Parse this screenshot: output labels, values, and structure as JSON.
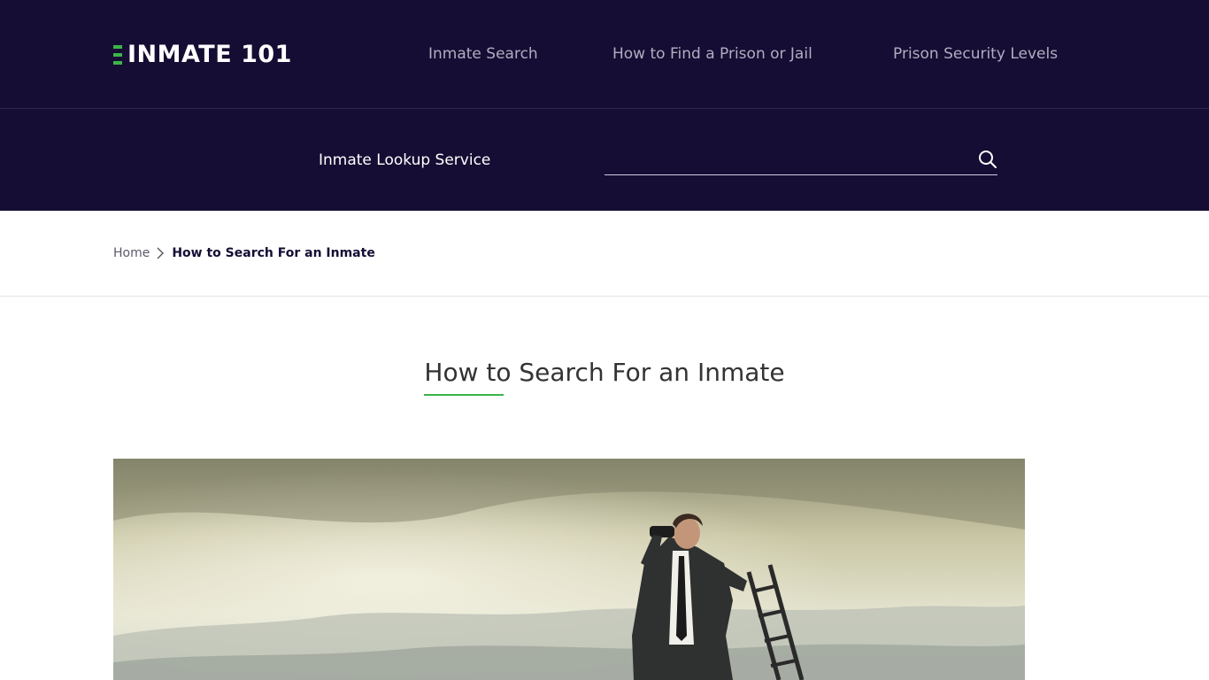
{
  "header": {
    "logo_text": "INMATE 101",
    "nav": [
      {
        "label": "Inmate Search"
      },
      {
        "label": "How to Find a Prison or Jail"
      },
      {
        "label": "Prison Security Levels"
      }
    ]
  },
  "search": {
    "label": "Inmate Lookup Service",
    "value": "",
    "placeholder": ""
  },
  "breadcrumb": {
    "home": "Home",
    "current": "How to Search For an Inmate"
  },
  "page": {
    "title": "How to Search For an Inmate"
  },
  "colors": {
    "header_bg": "#150d33",
    "accent_green": "#3bb54a",
    "nav_text": "#b1adc1"
  },
  "icons": {
    "search": "search-icon",
    "breadcrumb_separator": "chevron-right-icon",
    "logo": "logo-bars-icon"
  }
}
